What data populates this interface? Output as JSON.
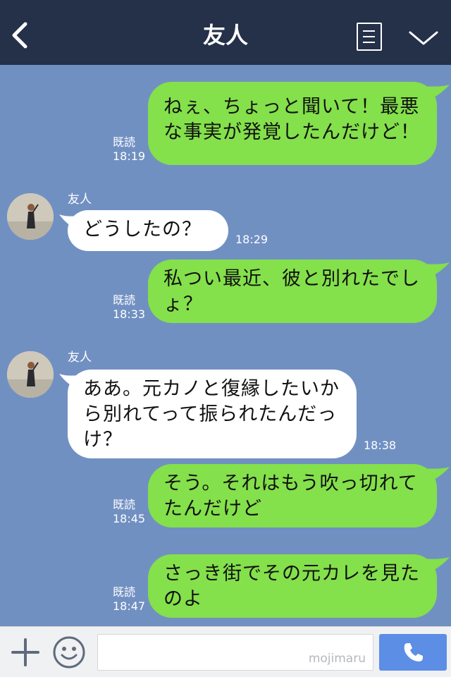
{
  "header": {
    "title": "友人"
  },
  "messages": [
    {
      "side": "me",
      "text": "ねぇ、ちょっと聞いて！最悪な事実が発覚したんだけど！",
      "read": "既読",
      "time": "18:19"
    },
    {
      "side": "friend",
      "sender": "友人",
      "text": "どうしたの？",
      "time": "18:29"
    },
    {
      "side": "me",
      "text": "私つい最近、彼と別れたでしょ？",
      "read": "既読",
      "time": "18:33"
    },
    {
      "side": "friend",
      "sender": "友人",
      "text": "ああ。元カノと復縁したいから別れてって振られたんだっけ？",
      "time": "18:38"
    },
    {
      "side": "me",
      "text": "そう。それはもう吹っ切れてたんだけど",
      "read": "既読",
      "time": "18:45"
    },
    {
      "side": "me",
      "text": "さっき街でその元カレを見たのよ",
      "read": "既読",
      "time": "18:47"
    }
  ],
  "footer": {
    "watermark": "mojimaru"
  },
  "colors": {
    "header_bg": "#253049",
    "chat_bg": "#7190c2",
    "my_bubble": "#84e04b",
    "friend_bubble": "#ffffff",
    "call_button": "#5c8ee6"
  },
  "icons": {
    "back": "chevron-left-icon",
    "menu": "menu-list-icon",
    "more": "chevron-down-icon",
    "plus": "plus-icon",
    "emoji": "smiley-icon",
    "call": "phone-icon"
  }
}
